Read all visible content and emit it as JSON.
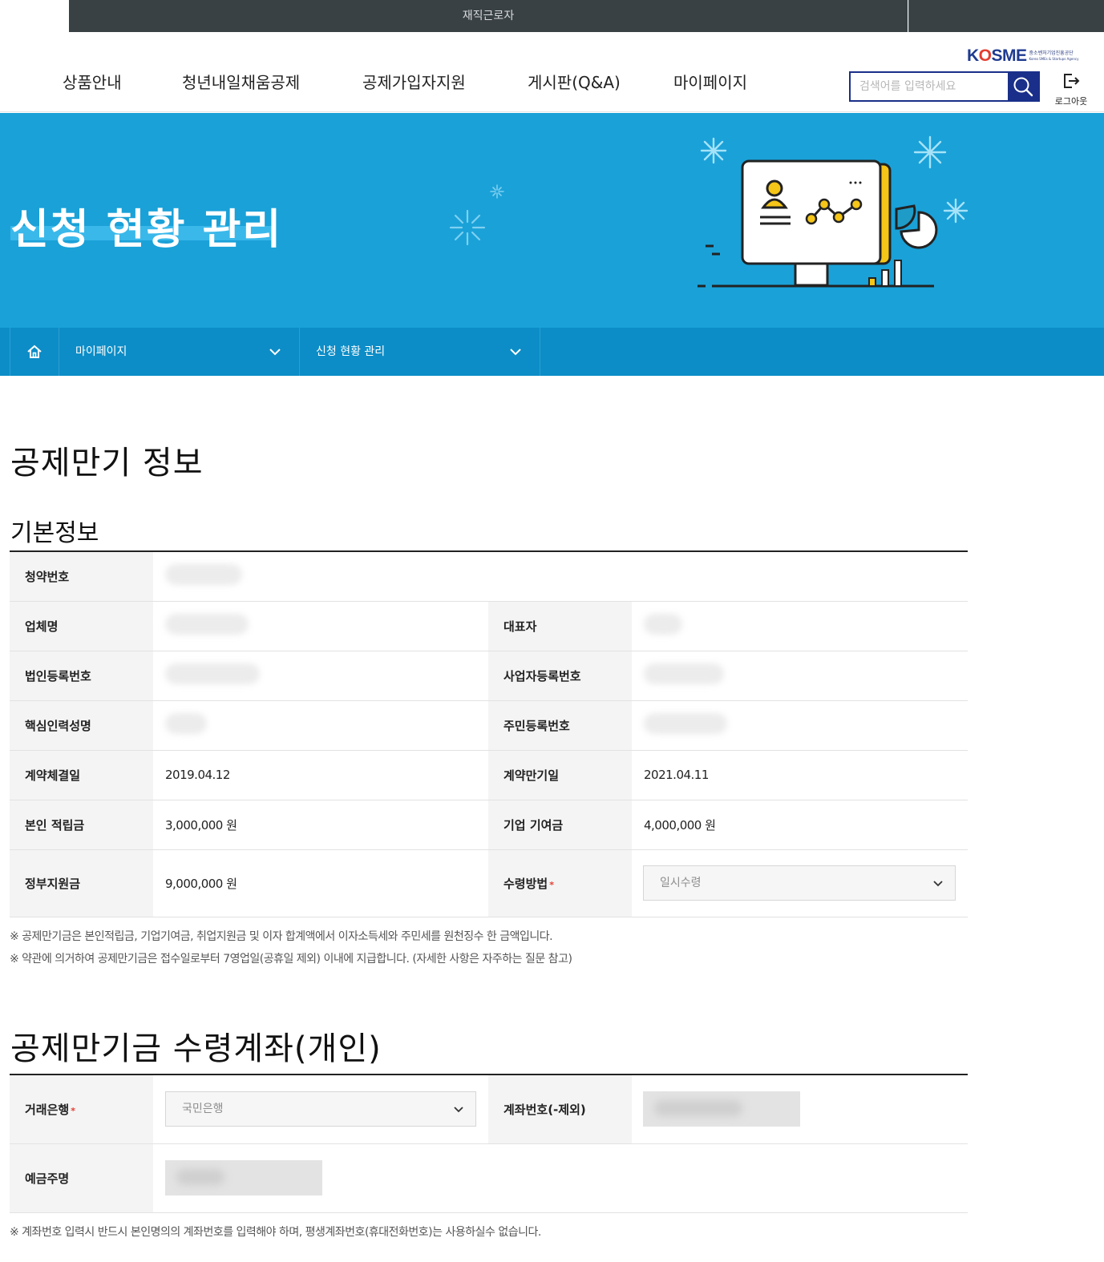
{
  "topbar": {
    "tab_label": "재직근로자"
  },
  "nav": {
    "items": [
      {
        "label": "상품안내"
      },
      {
        "label": "청년내일채움공제"
      },
      {
        "label": "공제가입자지원"
      },
      {
        "label": "게시판(Q&A)"
      },
      {
        "label": "마이페이지"
      }
    ]
  },
  "logo": {
    "text": "KOSME",
    "sub_line1": "중소벤처기업진흥공단",
    "sub_line2": "Korea SMEs & Startups Agency"
  },
  "search": {
    "placeholder": "검색어를 입력하세요",
    "icon": "search-icon"
  },
  "logout": {
    "label": "로그아웃",
    "icon": "logout-icon"
  },
  "banner": {
    "title": "신청 현황 관리",
    "accent_color": "#1aa1d8"
  },
  "breadcrumb": {
    "home_icon": "home-icon",
    "level1": "마이페이지",
    "level2": "신청 현황 관리"
  },
  "page": {
    "title": "공제만기 정보",
    "basic": {
      "heading": "기본정보",
      "labels": {
        "subscription_no": "청약번호",
        "company_name": "업체명",
        "ceo": "대표자",
        "corp_reg_no": "법인등록번호",
        "biz_reg_no": "사업자등록번호",
        "core_person_name": "핵심인력성명",
        "resident_no": "주민등록번호",
        "contract_date": "계약체결일",
        "expiry_date": "계약만기일",
        "self_savings": "본인 적립금",
        "company_contribution": "기업 기여금",
        "gov_support": "정부지원금",
        "receipt_method": "수령방법"
      },
      "values": {
        "contract_date": "2019.04.12",
        "expiry_date": "2021.04.11",
        "self_savings": "3,000,000 원",
        "company_contribution": "4,000,000 원",
        "gov_support": "9,000,000 원",
        "receipt_method": "일시수령"
      },
      "required_mark": "*"
    },
    "notes": [
      "※ 공제만기금은 본인적립금, 기업기여금, 취업지원금 및 이자 합계액에서 이자소득세와 주민세를 원천징수 한 금액입니다.",
      "※ 약관에 의거하여 공제만기금은 접수일로부터 7영업일(공휴일 제외) 이내에 지급합니다. (자세한 사항은 자주하는 질문 참고)"
    ],
    "account": {
      "heading": "공제만기금 수령계좌(개인)",
      "labels": {
        "bank": "거래은행",
        "account_no": "계좌번호(-제외)",
        "holder": "예금주명"
      },
      "values": {
        "bank": "국민은행"
      },
      "note": "※ 계좌번호 입력시 반드시 본인명의의 계좌번호를 입력해야 하며, 평생계좌번호(휴대전화번호)는 사용하실수 없습니다."
    }
  }
}
